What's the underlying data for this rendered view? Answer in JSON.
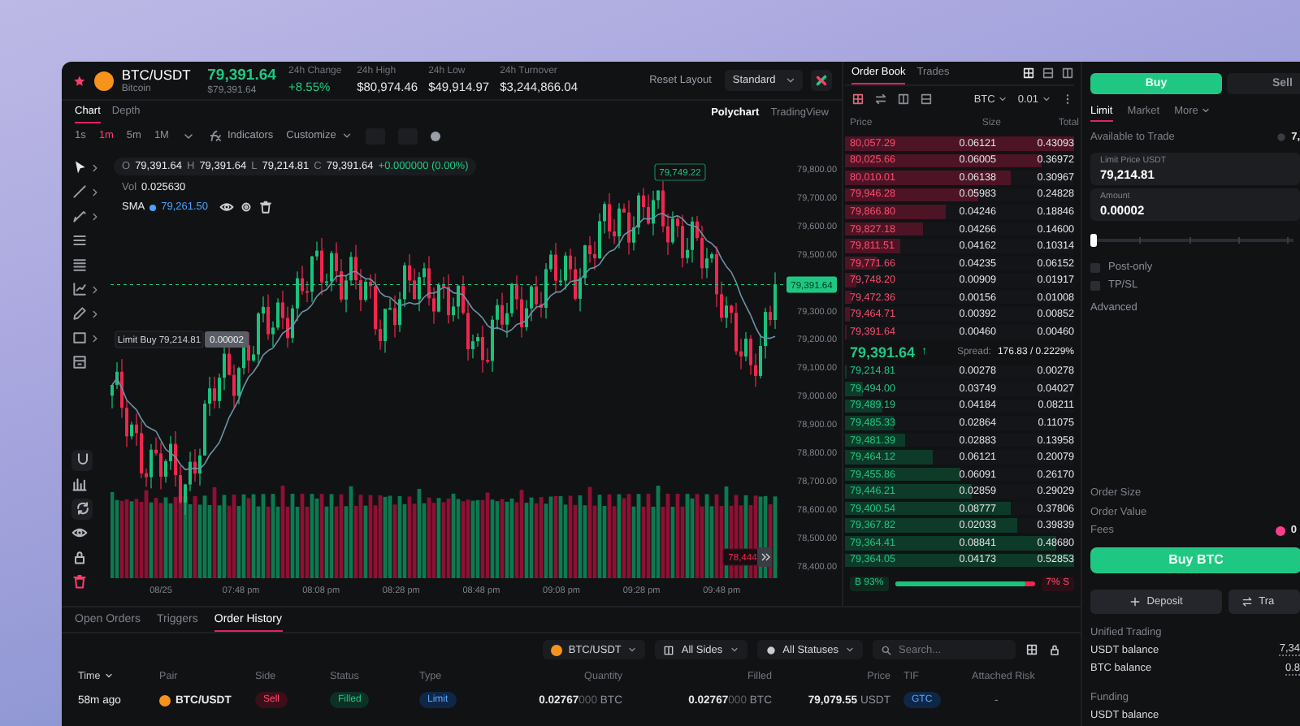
{
  "header": {
    "pair": "BTC/USDT",
    "name": "Bitcoin",
    "price": "79,391.64",
    "price_usd": "$79,391.64",
    "stats": [
      {
        "label": "24h Change",
        "value": "+8.55%",
        "kind": "up"
      },
      {
        "label": "24h High",
        "value": "$80,974.46",
        "kind": "plain"
      },
      {
        "label": "24h Low",
        "value": "$49,914.97",
        "kind": "plain"
      },
      {
        "label": "24h Turnover",
        "value": "$3,244,866.04",
        "kind": "plain"
      }
    ],
    "reset_label": "Reset Layout",
    "layout_select": "Standard"
  },
  "chart_tabs": [
    {
      "label": "Chart",
      "selected": true
    },
    {
      "label": "Depth",
      "selected": false
    }
  ],
  "engine_tabs": [
    {
      "label": "Polychart",
      "selected": true
    },
    {
      "label": "TradingView",
      "selected": false
    }
  ],
  "intervals": [
    {
      "label": "1s",
      "selected": false
    },
    {
      "label": "1m",
      "selected": true
    },
    {
      "label": "5m",
      "selected": false
    },
    {
      "label": "1M",
      "selected": false
    }
  ],
  "indicators_label": "Indicators",
  "customize_label": "Customize",
  "legend": {
    "ohlc": [
      {
        "label": "O",
        "value": "79,391.64"
      },
      {
        "label": "H",
        "value": "79,391.64"
      },
      {
        "label": "L",
        "value": "79,214.81"
      },
      {
        "label": "C",
        "value": "79,391.64"
      }
    ],
    "change": "+0.000000 (0.00%)",
    "volume_label": "Vol",
    "volume": "0.025630",
    "sma_label": "SMA",
    "sma": "79,261.50"
  },
  "chart": {
    "y_labels_upper": [
      "79,800.00",
      "79,700.00",
      "79,600.00",
      "79,500.00"
    ],
    "y_labels_lower": [
      "79,300.00",
      "79,200.00",
      "79,100.00",
      "79,000.00",
      "78,900.00",
      "78,800.00",
      "78,700.00",
      "78,600.00",
      "78,500.00",
      "78,400.00"
    ],
    "x_labels": [
      "08/25",
      "07:48 pm",
      "08:08 pm",
      "08:28 pm",
      "08:48 pm",
      "09:08 pm",
      "09:28 pm",
      "09:48 pm"
    ],
    "current_price": "79,391.64",
    "high_marker": "79,749.22",
    "order_label": "Limit Buy 79,214.81",
    "order_amount": "0.00002",
    "low_marker": "78,444"
  },
  "order_book": {
    "tabs": [
      {
        "label": "Order Book",
        "selected": true
      },
      {
        "label": "Trades",
        "selected": false
      }
    ],
    "asset": "BTC",
    "tick": "0.01",
    "columns": [
      "Price",
      "Size",
      "Total"
    ],
    "asks": [
      {
        "price": "80,057.29",
        "size": "0.06121",
        "total": "0.43093",
        "level": 1.0
      },
      {
        "price": "80,025.66",
        "size": "0.06005",
        "total": "0.36972",
        "level": 0.86
      },
      {
        "price": "80,010.01",
        "size": "0.06138",
        "total": "0.30967",
        "level": 0.72
      },
      {
        "price": "79,946.28",
        "size": "0.05983",
        "total": "0.24828",
        "level": 0.58
      },
      {
        "price": "79,866.80",
        "size": "0.04246",
        "total": "0.18846",
        "level": 0.44
      },
      {
        "price": "79,827.18",
        "size": "0.04266",
        "total": "0.14600",
        "level": 0.34
      },
      {
        "price": "79,811.51",
        "size": "0.04162",
        "total": "0.10314",
        "level": 0.24
      },
      {
        "price": "79,771.66",
        "size": "0.04235",
        "total": "0.06152",
        "level": 0.14
      },
      {
        "price": "79,748.20",
        "size": "0.00909",
        "total": "0.01917",
        "level": 0.05
      },
      {
        "price": "79,472.36",
        "size": "0.00156",
        "total": "0.01008",
        "level": 0.03
      },
      {
        "price": "79,464.71",
        "size": "0.00392",
        "total": "0.00852",
        "level": 0.02
      },
      {
        "price": "79,391.64",
        "size": "0.00460",
        "total": "0.00460",
        "level": 0.01
      }
    ],
    "last_price": "79,391.64",
    "last_arrow": "↑",
    "spread_label": "Spread:",
    "spread": "176.83 / 0.2229%",
    "bids": [
      {
        "price": "79,214.81",
        "size": "0.00278",
        "total": "0.00278",
        "level": 0.01
      },
      {
        "price": "79,494.00",
        "size": "0.03749",
        "total": "0.04027",
        "level": 0.08
      },
      {
        "price": "79,489.19",
        "size": "0.04184",
        "total": "0.08211",
        "level": 0.16
      },
      {
        "price": "79,485.33",
        "size": "0.02864",
        "total": "0.11075",
        "level": 0.21
      },
      {
        "price": "79,481.39",
        "size": "0.02883",
        "total": "0.13958",
        "level": 0.26
      },
      {
        "price": "79,464.12",
        "size": "0.06121",
        "total": "0.20079",
        "level": 0.38
      },
      {
        "price": "79,455.86",
        "size": "0.06091",
        "total": "0.26170",
        "level": 0.5
      },
      {
        "price": "79,446.21",
        "size": "0.02859",
        "total": "0.29029",
        "level": 0.55
      },
      {
        "price": "79,400.54",
        "size": "0.08777",
        "total": "0.37806",
        "level": 0.72
      },
      {
        "price": "79,367.82",
        "size": "0.02033",
        "total": "0.39839",
        "level": 0.75
      },
      {
        "price": "79,364.41",
        "size": "0.08841",
        "total": "0.48680",
        "level": 0.92
      },
      {
        "price": "79,364.05",
        "size": "0.04173",
        "total": "0.52853",
        "level": 1.0
      }
    ],
    "ratio": {
      "buy": "B 93%",
      "level": 0.93,
      "sell": "7% S"
    }
  },
  "trade": {
    "sides": [
      {
        "label": "Buy",
        "selected": true
      },
      {
        "label": "Sell",
        "selected": false
      }
    ],
    "order_types": [
      {
        "label": "Limit",
        "selected": true
      },
      {
        "label": "Market",
        "selected": false
      },
      {
        "label": "More",
        "selected": false
      }
    ],
    "available_label": "Available to Trade",
    "available": "7,",
    "fields": [
      {
        "label": "Limit Price USDT",
        "value": "79,214.81"
      },
      {
        "label": "Amount",
        "value": "0.00002"
      }
    ],
    "slider": {
      "level": 0
    },
    "options": [
      {
        "label": "Post-only",
        "checked": false
      },
      {
        "label": "TP/SL",
        "checked": false
      }
    ],
    "advanced": "Advanced",
    "summary": [
      {
        "label": "Order Size"
      },
      {
        "label": "Order Value"
      },
      {
        "label": "Fees",
        "value": "0"
      }
    ],
    "submit": "Buy BTC",
    "actions": [
      {
        "label": "Deposit",
        "kind": "deposit"
      },
      {
        "label": "Tra",
        "kind": "transfer"
      }
    ],
    "sections": [
      {
        "title": "Unified Trading",
        "rows": [
          {
            "label": "USDT balance",
            "value": "7,34"
          },
          {
            "label": "BTC balance",
            "value": "0.8"
          }
        ]
      },
      {
        "title": "Funding",
        "rows": [
          {
            "label": "USDT balance"
          }
        ]
      }
    ]
  },
  "orders": {
    "tabs": [
      {
        "label": "Open Orders",
        "selected": false
      },
      {
        "label": "Triggers",
        "selected": false
      },
      {
        "label": "Order History",
        "selected": true
      }
    ],
    "filters": [
      {
        "label": "BTC/USDT",
        "kind": "pair"
      },
      {
        "label": "All Sides",
        "kind": "sides"
      },
      {
        "label": "All Statuses",
        "kind": "status"
      }
    ],
    "search": {
      "placeholder": "Search..."
    },
    "columns": [
      {
        "label": "Time",
        "sorted": true
      },
      {
        "label": "Pair",
        "sorted": false
      },
      {
        "label": "Side",
        "sorted": false
      },
      {
        "label": "Status",
        "sorted": false
      },
      {
        "label": "Type",
        "sorted": false
      },
      {
        "label": "Quantity",
        "sorted": false
      },
      {
        "label": "Filled",
        "sorted": false
      },
      {
        "label": "Price",
        "sorted": false
      },
      {
        "label": "TIF",
        "sorted": false
      },
      {
        "label": "Attached Risk",
        "sorted": false
      }
    ],
    "rows": [
      {
        "time": "58m ago",
        "pair": "BTC/USDT",
        "side": "Sell",
        "status": "Filled",
        "type": "Limit",
        "quantity": "0.02767",
        "quantity_pad": "000",
        "quantity_unit": "BTC",
        "filled": "0.02767",
        "filled_pad": "000",
        "filled_unit": "BTC",
        "price": "79,079.55",
        "price_unit": "USDT",
        "tif": "GTC",
        "risk": "-"
      }
    ]
  }
}
